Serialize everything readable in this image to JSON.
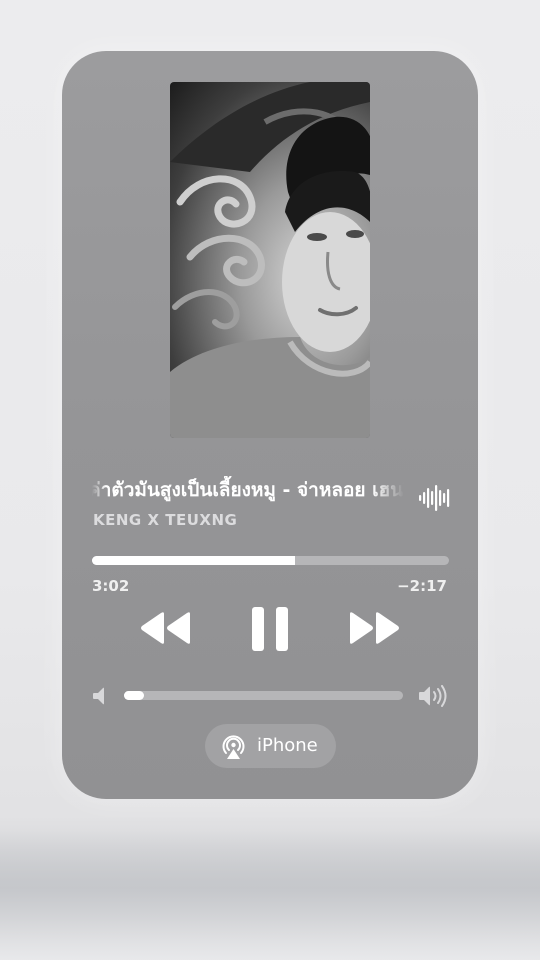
{
  "now_playing": {
    "title": "ค่าตัวมันสูงเป็นเลี้ยงหมู - จ่าหลอย เฮนรี่ - [ KENG X TEUXNG ]",
    "artist": "KENG X TEUXNG",
    "elapsed": "3:02",
    "remaining": "−2:17",
    "progress": 0.57
  },
  "controls": {
    "rewind_icon": "backward-icon",
    "pause_icon": "pause-icon",
    "forward_icon": "forward-icon"
  },
  "volume": {
    "level": 0.07,
    "low_icon": "speaker-low-icon",
    "high_icon": "speaker-high-icon"
  },
  "output": {
    "icon": "airplay-icon",
    "label": "iPhone"
  },
  "colors": {
    "card": "#979799",
    "fill": "#ffffff",
    "track": "#b6b6b8"
  }
}
